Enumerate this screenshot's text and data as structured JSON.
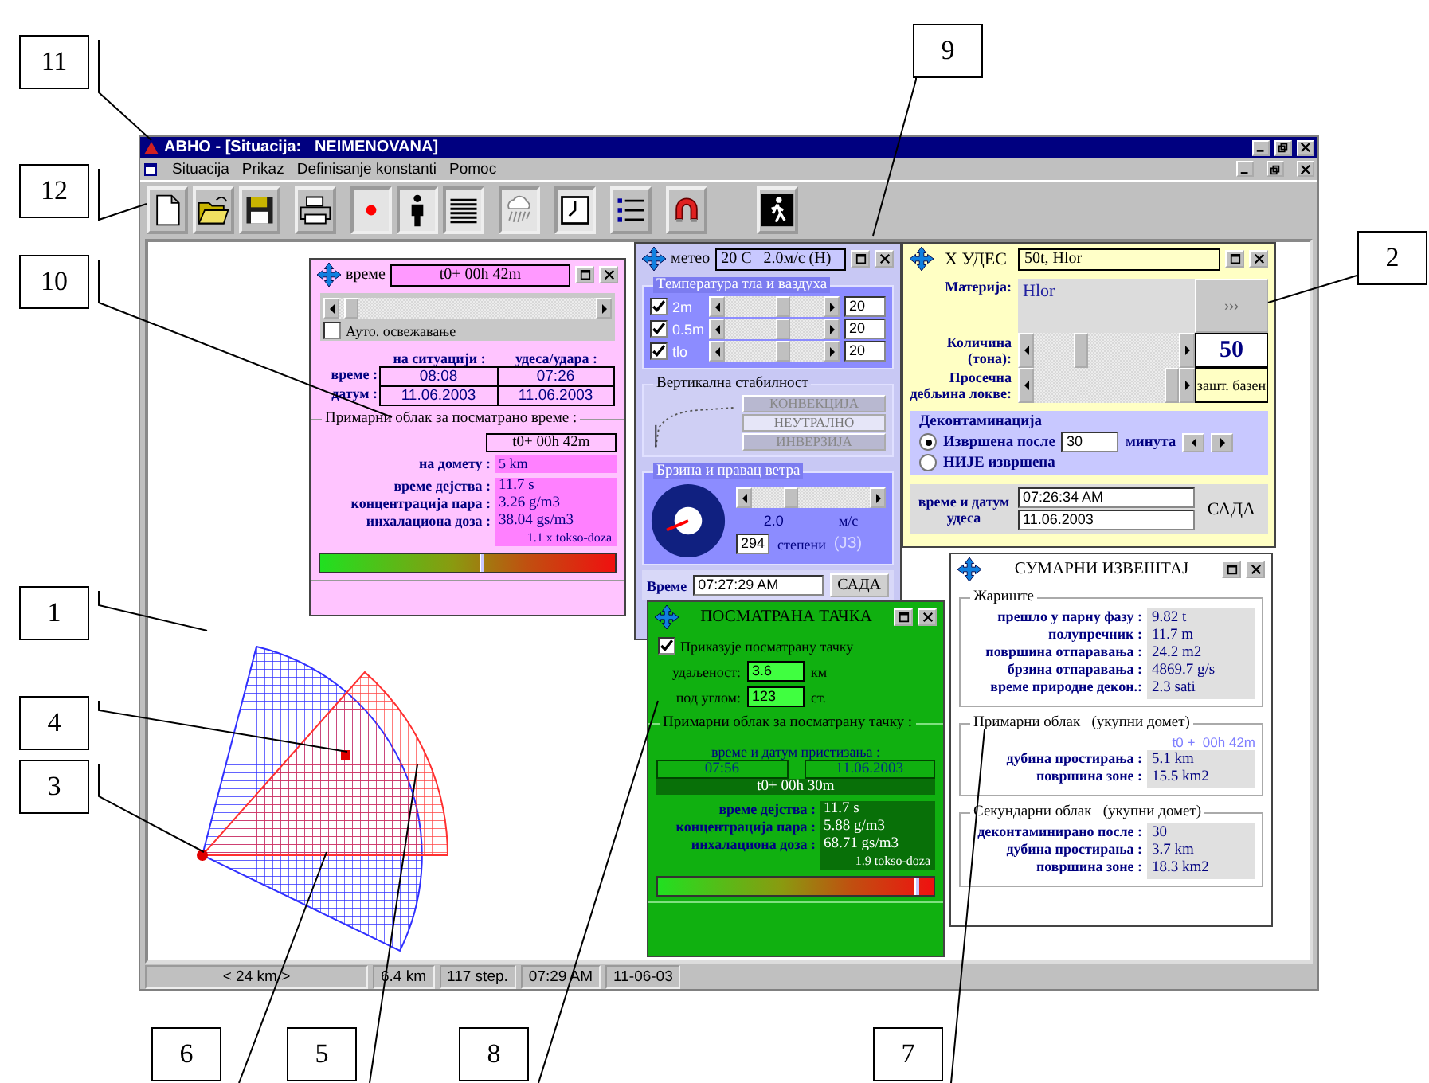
{
  "callouts": [
    {
      "label": "11"
    },
    {
      "label": "12"
    },
    {
      "label": "10"
    },
    {
      "label": "1"
    },
    {
      "label": "4"
    },
    {
      "label": "3"
    },
    {
      "label": "9"
    },
    {
      "label": "2"
    },
    {
      "label": "6"
    },
    {
      "label": "5"
    },
    {
      "label": "8"
    },
    {
      "label": "7"
    }
  ],
  "window": {
    "title": "ABHO - [Situacija:   NEIMENOVANA]"
  },
  "menu": [
    "Situacija",
    "Prikaz",
    "Definisanje konstanti",
    "Pomoc"
  ],
  "toolbar": [
    {
      "kind": "new",
      "pressed": false
    },
    {
      "kind": "open",
      "pressed": false
    },
    {
      "kind": "save",
      "pressed": false
    },
    {
      "kind": "print",
      "pressed": false
    },
    {
      "kind": "point",
      "pressed": true
    },
    {
      "kind": "person",
      "pressed": true
    },
    {
      "kind": "lines",
      "pressed": true
    },
    {
      "kind": "weather",
      "pressed": true
    },
    {
      "kind": "clock",
      "pressed": true
    },
    {
      "kind": "list",
      "pressed": false
    },
    {
      "kind": "magnet",
      "pressed": false
    },
    {
      "kind": "walk",
      "pressed": false
    }
  ],
  "time_panel": {
    "title": "време",
    "time_field": "t0+ 00h 42m",
    "slider": {
      "level": 0.02
    },
    "auto_refresh": {
      "label": "Ауто. освежавање",
      "checked": false
    },
    "columns": [
      "на ситуацији :",
      "удеса/удара :"
    ],
    "rows": [
      {
        "label": "време :",
        "values": [
          "08:08",
          "07:26"
        ]
      },
      {
        "label": "датум :",
        "values": [
          "11.06.2003",
          "11.06.2003"
        ]
      }
    ],
    "group_title": "Примарни облак за посматрано време :",
    "elapsed": "t0+ 00h 42m",
    "range_label": "на домету :",
    "range_value": "5 km",
    "stats": [
      {
        "label": "време дејства :",
        "value": "11.7 s"
      },
      {
        "label": "концентрација пара :",
        "value": "3.26 g/m3"
      },
      {
        "label": "инхалациона доза :",
        "value": "38.04 gs/m3"
      }
    ],
    "dose_note": "1.1 x tokso-doza",
    "dose_bar": {
      "level": 0.54
    }
  },
  "meteo_panel": {
    "title": "метео",
    "summary": "20 C   2.0м/с (Н)",
    "temp_title": "Температура тла и ваздуха",
    "temps": [
      {
        "label": "2m",
        "checked": true,
        "level": 0.6,
        "value": "20"
      },
      {
        "label": "0.5m",
        "checked": true,
        "level": 0.6,
        "value": "20"
      },
      {
        "label": "tlo",
        "checked": true,
        "level": 0.6,
        "value": "20"
      }
    ],
    "stability_title": "Вертикална стабилност",
    "stability": [
      {
        "label": "КОНВЕКЦИЈА",
        "selected": false
      },
      {
        "label": "НЕУТРАЛНО",
        "selected": true
      },
      {
        "label": "ИНВЕРЗИЈА",
        "selected": false
      }
    ],
    "wind_title": "Брзина и правац ветра",
    "wind_slider": {
      "level": 0.3
    },
    "wind_speed": "2.0",
    "wind_unit": "м/с",
    "direction": "294",
    "direction_unit": "степени",
    "direction_name": "(ЈЗ)",
    "time_label": "Време",
    "time": "07:27:29 AM",
    "now_button": "САДА"
  },
  "accident_panel": {
    "title": "X УДЕС",
    "summary": "50t, Hlor",
    "substance_label": "Материја:",
    "substance": "Hlor",
    "more_button": "›››",
    "amount_label": "Количина (тона):",
    "amount_slider": {
      "level": 0.3
    },
    "amount": "50",
    "depth_label": "Просечна дебљина локве:",
    "depth_slider": {
      "level": 1
    },
    "depth_value": "зашт. базен",
    "decon_title": "Деконтаминација",
    "decon_options": [
      {
        "label": "Извршена после",
        "selected": true
      },
      {
        "label": "НИЈЕ извршена",
        "selected": false
      }
    ],
    "decon_minutes": "30",
    "decon_unit": "минута",
    "datetime_label": "време и датум удеса",
    "time": "07:26:34 AM",
    "date": "11.06.2003",
    "now_button": "САДА"
  },
  "summary_panel": {
    "title": "СУМАРНИ ИЗВЕШТАЈ",
    "groups": [
      {
        "title": "Жариште",
        "rows": [
          {
            "label": "прешло у парну фазу :",
            "value": "9.82 t"
          },
          {
            "label": "полупречник :",
            "value": "11.7 m"
          },
          {
            "label": "површина отпаравања :",
            "value": "24.2 m2"
          },
          {
            "label": "брзина отпаравања :",
            "value": "4869.7 g/s"
          },
          {
            "label": "време природне декон.:",
            "value": "2.3 sati"
          }
        ]
      },
      {
        "title": "Примарни облак   (укупни домет)",
        "note": "t0 +  00h 42m",
        "rows": [
          {
            "label": "дубина простирања :",
            "value": "5.1 km"
          },
          {
            "label": "површина зоне :",
            "value": "15.5 km2"
          }
        ]
      },
      {
        "title": "Секундарни облак   (укупни домет)",
        "rows": [
          {
            "label": "деконтаминирано после :",
            "value": "30"
          },
          {
            "label": "дубина простирања :",
            "value": "3.7 km"
          },
          {
            "label": "површина зоне :",
            "value": "18.3 km2"
          }
        ]
      }
    ]
  },
  "point_panel": {
    "title": "ПОСМАТРАНА ТАЧКА",
    "show_point": {
      "label": "Приказује посматрану тачку",
      "checked": true
    },
    "fields": [
      {
        "label": "удаљеност:",
        "value": "3.6",
        "unit": "км"
      },
      {
        "label": "под углом:",
        "value": "123",
        "unit": "ст."
      }
    ],
    "group_title": "Примарни облак за посматрану тачку :",
    "arrival_label": "време и датум пристизања :",
    "arrival_time": "07:56",
    "arrival_date": "11.06.2003",
    "elapsed": "t0+ 00h 30m",
    "stats": [
      {
        "label": "време дејства :",
        "value": "11.7 s"
      },
      {
        "label": "концентрација пара :",
        "value": "5.88 g/m3"
      },
      {
        "label": "инхалациона доза :",
        "value": "68.71 gs/m3"
      }
    ],
    "dose_note": "1.9 tokso-doza",
    "dose_bar": {
      "level": 0.93
    }
  },
  "status_bar": [
    "< 24 km >",
    "6.4 km",
    "117 step.",
    "07:29 AM",
    "11-06-03"
  ]
}
